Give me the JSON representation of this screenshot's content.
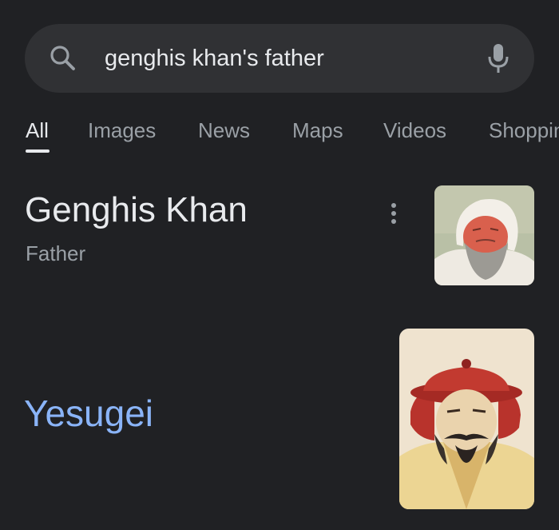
{
  "search": {
    "query": "genghis khan's father",
    "search_icon": "search-icon",
    "mic_icon": "microphone-icon"
  },
  "tabs": [
    {
      "label": "All",
      "active": true
    },
    {
      "label": "Images",
      "active": false
    },
    {
      "label": "News",
      "active": false
    },
    {
      "label": "Maps",
      "active": false
    },
    {
      "label": "Videos",
      "active": false
    },
    {
      "label": "Shopping",
      "active": false
    }
  ],
  "answer": {
    "title": "Genghis Khan",
    "subtitle": "Father",
    "more_icon": "more-vert-icon",
    "result": "Yesugei"
  },
  "colors": {
    "background": "#202124",
    "search_bar": "#303134",
    "text_primary": "#e8eaed",
    "text_secondary": "#9aa0a6",
    "link": "#8ab4f8"
  }
}
